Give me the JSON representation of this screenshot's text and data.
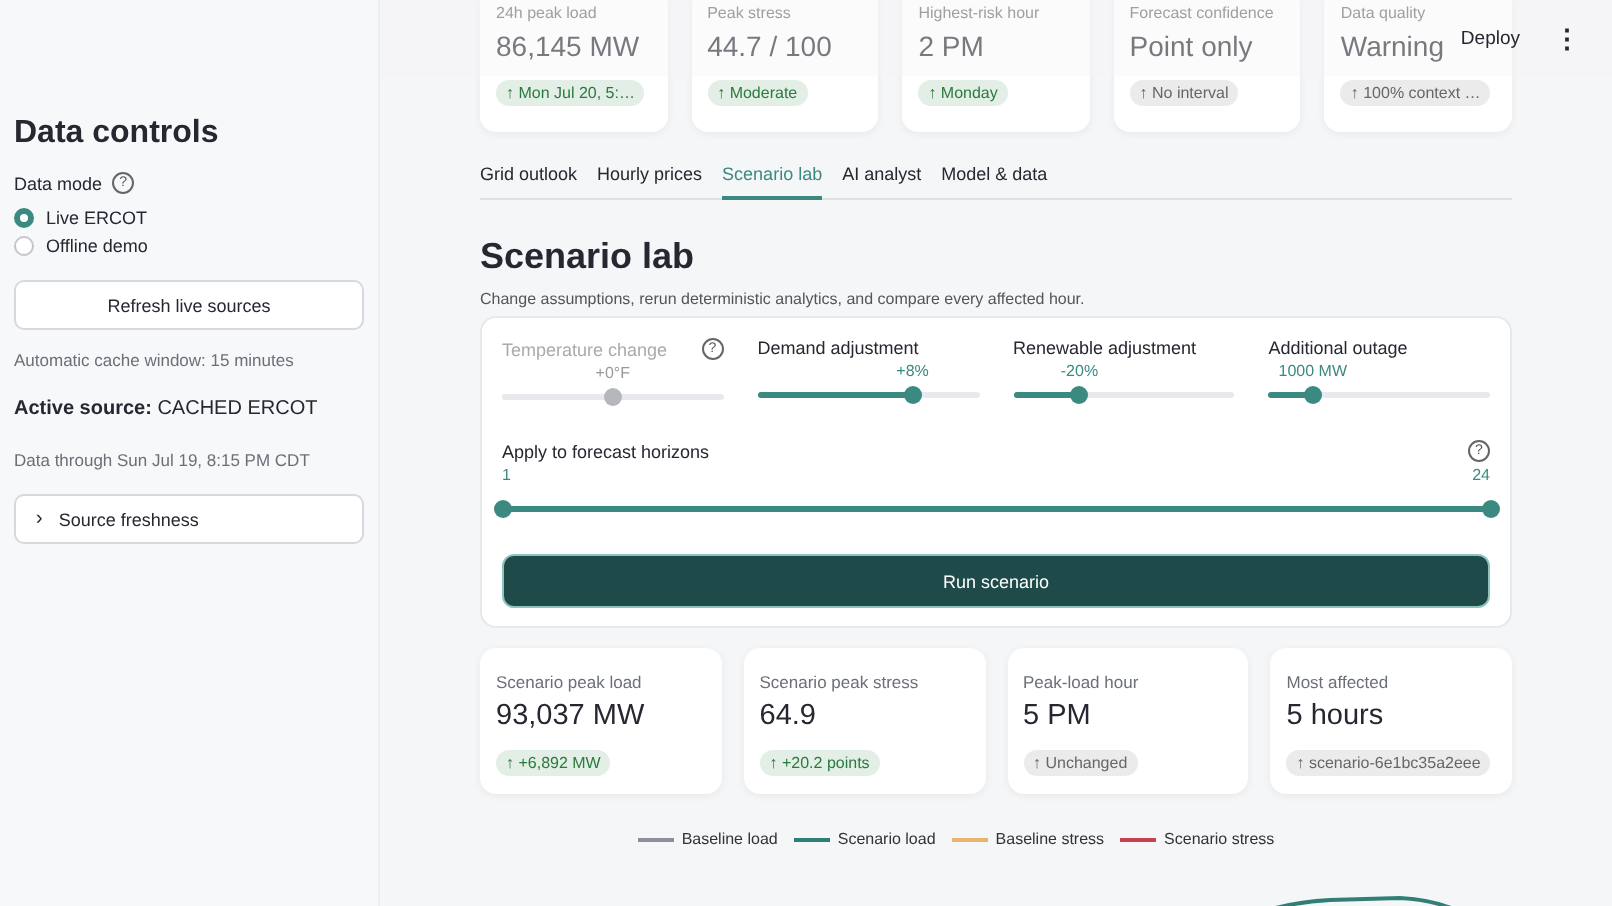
{
  "header": {
    "deploy": "Deploy",
    "menu": "⋮"
  },
  "sidebar": {
    "title": "Data controls",
    "data_mode": {
      "label": "Data mode",
      "help": "?",
      "options": [
        {
          "label": "Live ERCOT",
          "selected": true
        },
        {
          "label": "Offline demo",
          "selected": false
        }
      ]
    },
    "refresh_button": "Refresh live sources",
    "cache_note": "Automatic cache window: 15 minutes",
    "active_source": "**Active source:** CACHED ERCOT",
    "data_through": "Data through Sun Jul 19, 8:15 PM CDT",
    "expander": {
      "label": "Source freshness",
      "chevron": "›",
      "expanded": false
    }
  },
  "metrics": [
    {
      "label": "24h peak load",
      "value": "86,145 MW",
      "delta": "↑ Mon Jul 20, 5:…",
      "color": "#2b7a3d"
    },
    {
      "label": "Peak stress",
      "value": "44.7 / 100",
      "delta": "↑ Moderate",
      "color": "#2b7a3d"
    },
    {
      "label": "Highest-risk hour",
      "value": "2 PM",
      "delta": "↑ Monday",
      "color": "#2b7a3d"
    },
    {
      "label": "Forecast confidence",
      "value": "Point only",
      "delta": "↑ No interval",
      "color": "#666666"
    },
    {
      "label": "Data quality",
      "value": "Warning",
      "delta": "↑ 100% context …",
      "color": "#666666"
    }
  ],
  "tabs": [
    {
      "label": "Grid outlook",
      "selected": false
    },
    {
      "label": "Hourly prices",
      "selected": false
    },
    {
      "label": "Scenario lab",
      "selected": true
    },
    {
      "label": "AI analyst",
      "selected": false
    },
    {
      "label": "Model & data",
      "selected": false
    }
  ],
  "scenario": {
    "title": "Scenario lab",
    "description": "Change assumptions, rerun deterministic analytics, and compare every affected hour.",
    "sliders": [
      {
        "label": "Temperature change",
        "value": "+0°F",
        "level": 0.5,
        "disabled": true,
        "help": "?"
      },
      {
        "label": "Demand adjustment",
        "value": "+8%",
        "level": 0.7,
        "disabled": false
      },
      {
        "label": "Renewable adjustment",
        "value": "-20%",
        "level": 0.3,
        "disabled": false
      },
      {
        "label": "Additional outage",
        "value": "1000 MW",
        "level": 0.2,
        "disabled": false
      }
    ],
    "horizons": {
      "label": "Apply to forecast horizons",
      "help": "?",
      "thumbs": [
        {
          "value": "1",
          "level": 0
        },
        {
          "value": "24",
          "level": 1
        }
      ]
    },
    "run_button": "Run scenario"
  },
  "results": [
    {
      "label": "Scenario peak load",
      "value": "93,037 MW",
      "delta": "↑ +6,892 MW",
      "color": "#2b7a3d"
    },
    {
      "label": "Scenario peak stress",
      "value": "64.9",
      "delta": "↑ +20.2 points",
      "color": "#2b7a3d"
    },
    {
      "label": "Peak-load hour",
      "value": "5 PM",
      "delta": "↑ Unchanged",
      "color": "#666666"
    },
    {
      "label": "Most affected",
      "value": "5 hours",
      "delta": "↑ scenario-6e1bc35a2eee",
      "color": "#666666"
    }
  ],
  "chart": {
    "legend": [
      {
        "name": "Baseline load",
        "color": "#8c9099"
      },
      {
        "name": "Scenario load",
        "color": "#2f7f76"
      },
      {
        "name": "Baseline stress",
        "color": "#e9b46f"
      },
      {
        "name": "Scenario stress",
        "color": "#c9424f"
      }
    ]
  }
}
